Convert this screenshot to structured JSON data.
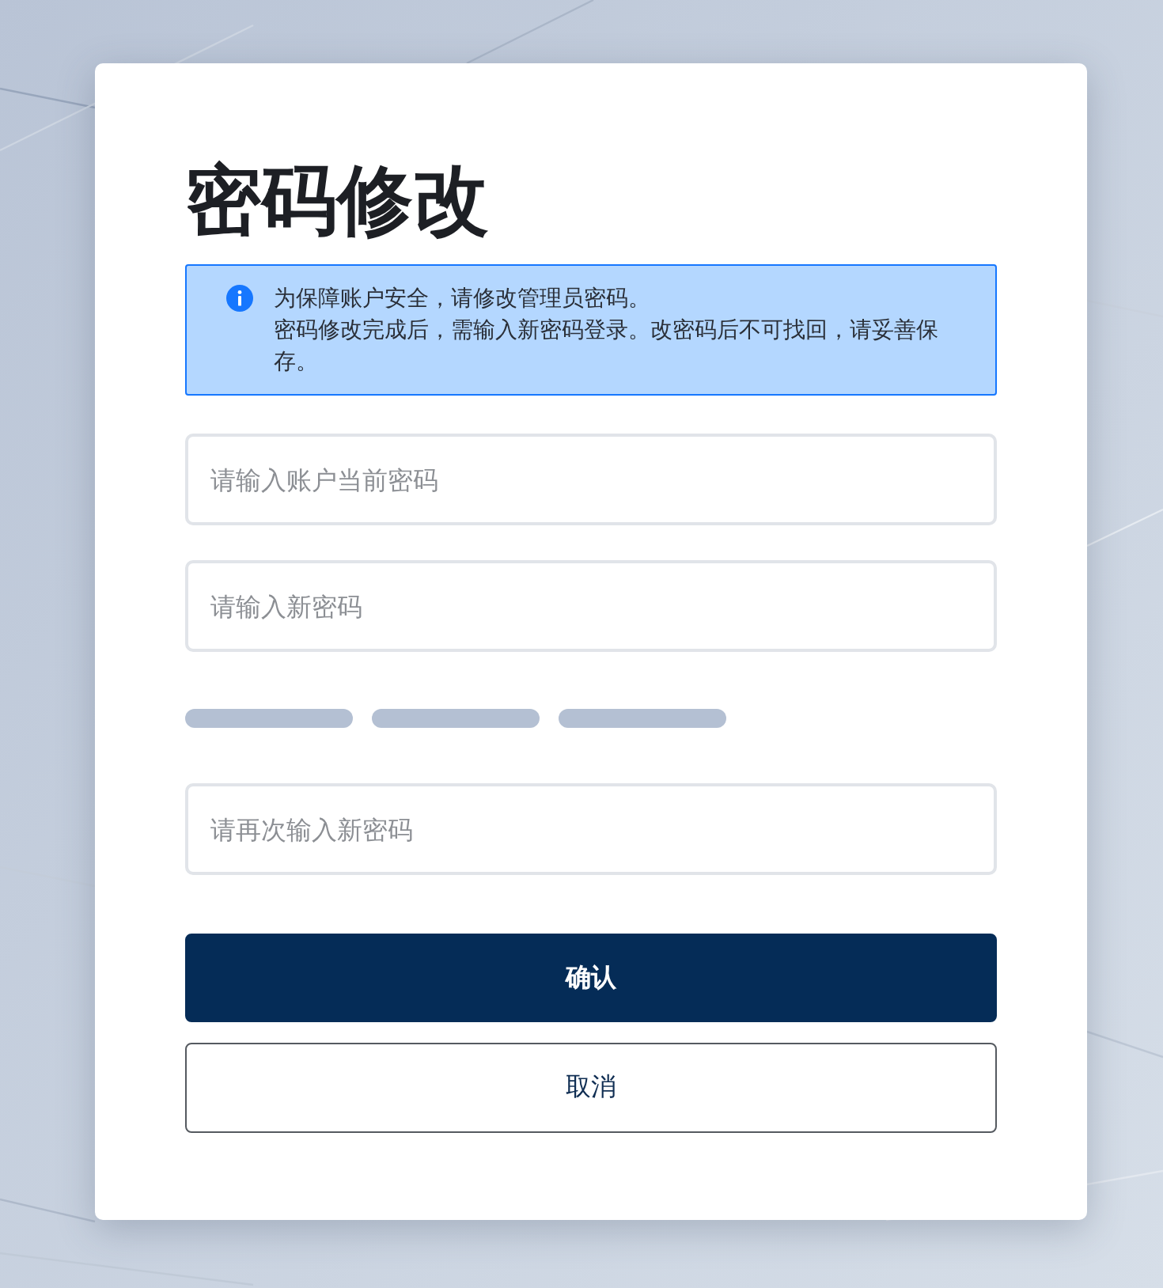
{
  "title": "密码修改",
  "notice": {
    "lines": [
      "为保障账户安全，请修改管理员密码。",
      "密码修改完成后，需输入新密码登录。改密码后不可找回，请妥善保存。"
    ]
  },
  "form_items": [
    {
      "kind": "password",
      "placeholder": "请输入账户当前密码"
    },
    {
      "kind": "password",
      "placeholder": "请输入新密码"
    },
    {
      "kind": "strength",
      "segments": [
        {
          "active": false
        },
        {
          "active": false
        },
        {
          "active": false
        }
      ]
    },
    {
      "kind": "password",
      "placeholder": "请再次输入新密码"
    }
  ],
  "buttons": [
    {
      "kind": "primary",
      "label": "确认"
    },
    {
      "kind": "secondary",
      "label": "取消"
    }
  ]
}
